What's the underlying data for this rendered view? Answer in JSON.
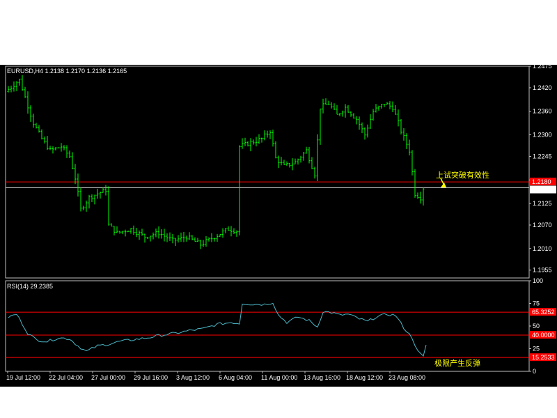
{
  "colors": {
    "background": "#000000",
    "grid_border": "#c0c0c0",
    "candle": "#00ff00",
    "rsi_line": "#4cb8c8",
    "level_line": "#ff0000",
    "axis_text": "#ffffff",
    "annotation": "#ffff00",
    "tag_bg": "#ff0000"
  },
  "icons": {
    "arrow": "yellow-arrow-icon"
  },
  "price_panel": {
    "header": "EURUSD,H4  1.2138 1.2170 1.2136 1.2165",
    "current_price_tag": "1.2165",
    "resistance_tag": "1.2180",
    "annotation": "上试突破有效性"
  },
  "rsi_panel": {
    "header": "RSI(14)  29.2385",
    "level_tags": [
      "65.3252",
      "40.0000",
      "15.2533"
    ],
    "annotation": "极限产生反弹"
  },
  "chart_data": [
    {
      "type": "candlestick",
      "title": "EURUSD,H4",
      "ohlc_last": {
        "open": 1.2138,
        "high": 1.217,
        "low": 1.2136,
        "close": 1.2165
      },
      "ylim": [
        1.1935,
        1.2475
      ],
      "y_ticks": [
        "1.2475",
        "1.2420",
        "1.2360",
        "1.2300",
        "1.2245",
        "1.2185",
        "1.2125",
        "1.2070",
        "1.2010",
        "1.1955"
      ],
      "x_ticks": [
        "19 Jul 12:00",
        "22 Jul 04:00",
        "27 Jul 00:00",
        "29 Jul 16:00",
        "3 Aug 12:00",
        "6 Aug 04:00",
        "11 Aug 00:00",
        "13 Aug 16:00",
        "18 Aug 12:00",
        "23 Aug 08:00"
      ],
      "horizontal_levels": [
        1.218,
        1.2165
      ],
      "bar_count": 150,
      "close_path": [
        {
          "bar": 0,
          "close": 1.241
        },
        {
          "bar": 5,
          "close": 1.244
        },
        {
          "bar": 10,
          "close": 1.233
        },
        {
          "bar": 13,
          "close": 1.229
        },
        {
          "bar": 16,
          "close": 1.226
        },
        {
          "bar": 20,
          "close": 1.227
        },
        {
          "bar": 23,
          "close": 1.2245
        },
        {
          "bar": 25,
          "close": 1.219
        },
        {
          "bar": 27,
          "close": 1.211
        },
        {
          "bar": 30,
          "close": 1.214
        },
        {
          "bar": 33,
          "close": 1.215
        },
        {
          "bar": 36,
          "close": 1.216
        },
        {
          "bar": 37,
          "close": 1.207
        },
        {
          "bar": 40,
          "close": 1.205
        },
        {
          "bar": 45,
          "close": 1.206
        },
        {
          "bar": 50,
          "close": 1.204
        },
        {
          "bar": 55,
          "close": 1.205
        },
        {
          "bar": 60,
          "close": 1.203
        },
        {
          "bar": 65,
          "close": 1.204
        },
        {
          "bar": 70,
          "close": 1.202
        },
        {
          "bar": 75,
          "close": 1.204
        },
        {
          "bar": 80,
          "close": 1.206
        },
        {
          "bar": 83,
          "close": 1.2055
        },
        {
          "bar": 84,
          "close": 1.227
        },
        {
          "bar": 88,
          "close": 1.228
        },
        {
          "bar": 92,
          "close": 1.229
        },
        {
          "bar": 95,
          "close": 1.231
        },
        {
          "bar": 97,
          "close": 1.224
        },
        {
          "bar": 100,
          "close": 1.222
        },
        {
          "bar": 104,
          "close": 1.223
        },
        {
          "bar": 108,
          "close": 1.226
        },
        {
          "bar": 111,
          "close": 1.22
        },
        {
          "bar": 113,
          "close": 1.237
        },
        {
          "bar": 116,
          "close": 1.238
        },
        {
          "bar": 119,
          "close": 1.235
        },
        {
          "bar": 122,
          "close": 1.237
        },
        {
          "bar": 126,
          "close": 1.234
        },
        {
          "bar": 129,
          "close": 1.23
        },
        {
          "bar": 132,
          "close": 1.236
        },
        {
          "bar": 136,
          "close": 1.238
        },
        {
          "bar": 139,
          "close": 1.237
        },
        {
          "bar": 142,
          "close": 1.231
        },
        {
          "bar": 145,
          "close": 1.226
        },
        {
          "bar": 147,
          "close": 1.215
        },
        {
          "bar": 149,
          "close": 1.214
        },
        {
          "bar": 150,
          "close": 1.2165
        }
      ]
    },
    {
      "type": "line",
      "title": "RSI(14)",
      "value_last": 29.2385,
      "ylim": [
        0,
        100
      ],
      "y_ticks": [
        "100",
        "75",
        "50",
        "25",
        "0"
      ],
      "horizontal_levels": [
        65.3252,
        40.0,
        15.2533
      ],
      "series": [
        {
          "points": [
            {
              "bar": 0,
              "value": 60
            },
            {
              "bar": 3,
              "value": 63
            },
            {
              "bar": 7,
              "value": 42
            },
            {
              "bar": 10,
              "value": 35
            },
            {
              "bar": 14,
              "value": 33
            },
            {
              "bar": 18,
              "value": 37
            },
            {
              "bar": 22,
              "value": 36
            },
            {
              "bar": 25,
              "value": 28
            },
            {
              "bar": 28,
              "value": 22
            },
            {
              "bar": 32,
              "value": 28
            },
            {
              "bar": 36,
              "value": 30
            },
            {
              "bar": 40,
              "value": 33
            },
            {
              "bar": 45,
              "value": 35
            },
            {
              "bar": 50,
              "value": 37
            },
            {
              "bar": 55,
              "value": 40
            },
            {
              "bar": 60,
              "value": 42
            },
            {
              "bar": 65,
              "value": 45
            },
            {
              "bar": 70,
              "value": 47
            },
            {
              "bar": 75,
              "value": 52
            },
            {
              "bar": 80,
              "value": 54
            },
            {
              "bar": 83,
              "value": 53
            },
            {
              "bar": 84,
              "value": 75
            },
            {
              "bar": 88,
              "value": 74
            },
            {
              "bar": 92,
              "value": 74
            },
            {
              "bar": 95,
              "value": 76
            },
            {
              "bar": 97,
              "value": 62
            },
            {
              "bar": 100,
              "value": 54
            },
            {
              "bar": 104,
              "value": 60
            },
            {
              "bar": 108,
              "value": 56
            },
            {
              "bar": 111,
              "value": 49
            },
            {
              "bar": 113,
              "value": 66
            },
            {
              "bar": 116,
              "value": 65
            },
            {
              "bar": 119,
              "value": 62
            },
            {
              "bar": 122,
              "value": 63
            },
            {
              "bar": 126,
              "value": 58
            },
            {
              "bar": 129,
              "value": 55
            },
            {
              "bar": 132,
              "value": 60
            },
            {
              "bar": 136,
              "value": 63
            },
            {
              "bar": 139,
              "value": 62
            },
            {
              "bar": 142,
              "value": 48
            },
            {
              "bar": 145,
              "value": 37
            },
            {
              "bar": 147,
              "value": 22
            },
            {
              "bar": 149,
              "value": 16
            },
            {
              "bar": 150,
              "value": 29.2385
            }
          ]
        }
      ]
    }
  ]
}
